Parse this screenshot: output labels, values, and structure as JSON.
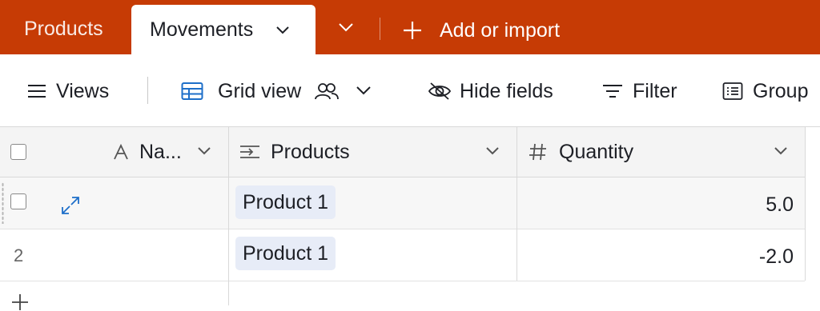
{
  "tabs": {
    "inactive_label": "Products",
    "active_label": "Movements",
    "add_label": "Add or import"
  },
  "toolbar": {
    "views_label": "Views",
    "grid_view_label": "Grid view",
    "hide_fields_label": "Hide fields",
    "filter_label": "Filter",
    "group_label": "Group"
  },
  "grid": {
    "columns": [
      {
        "label": "Na...",
        "icon": "text-field-icon"
      },
      {
        "label": "Products",
        "icon": "linked-record-icon"
      },
      {
        "label": "Quantity",
        "icon": "number-field-icon"
      }
    ],
    "rows": [
      {
        "row_number": "",
        "name": "",
        "product": "Product 1",
        "quantity": "5.0"
      },
      {
        "row_number": "2",
        "name": "",
        "product": "Product 1",
        "quantity": "-2.0"
      }
    ]
  },
  "colors": {
    "tab_bar": "#c63b05",
    "header_bg": "#f4f4f4",
    "chip_bg": "#e7ecf7",
    "accent_blue": "#1e6fc9"
  }
}
